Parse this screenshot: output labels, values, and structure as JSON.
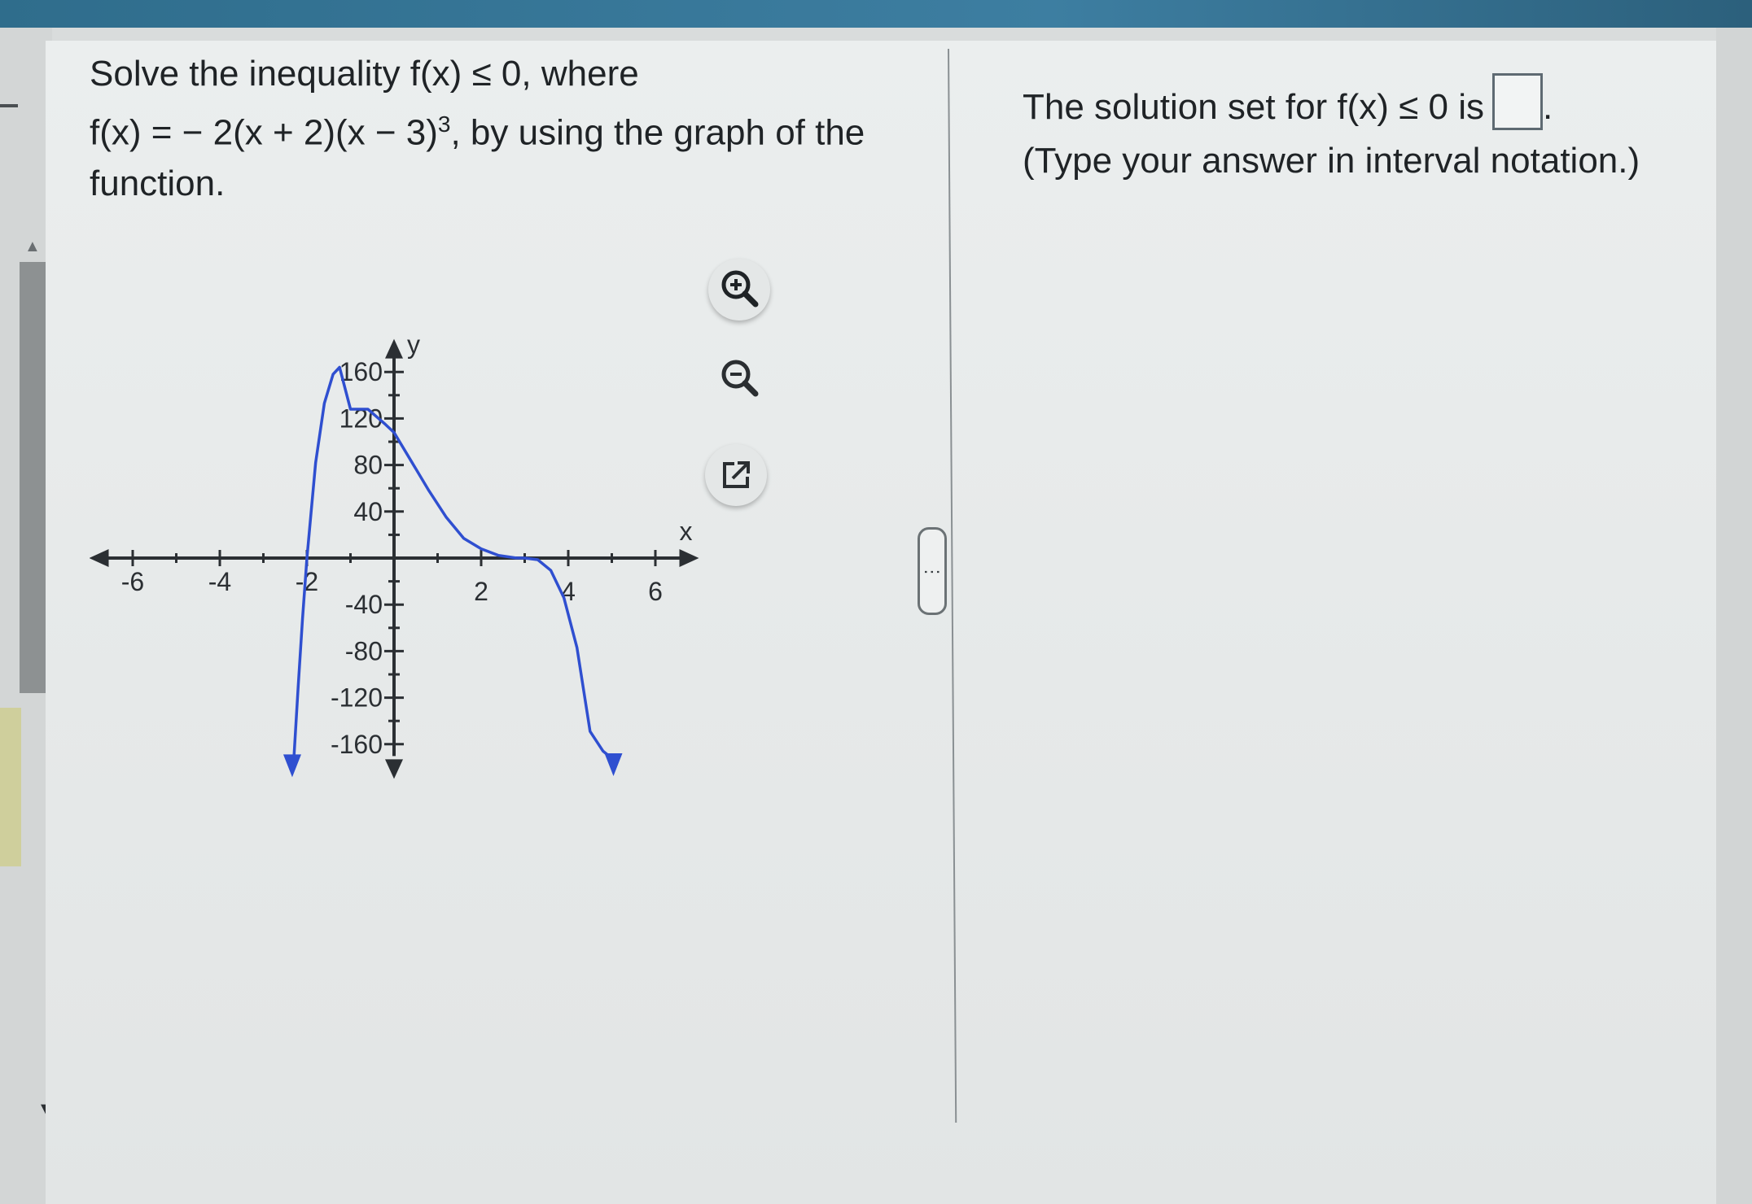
{
  "question": {
    "line1": "Solve the inequality f(x) ≤ 0, where",
    "line2_main": "f(x) = − 2(x + 2)(x − 3)",
    "line2_exp": "3",
    "line2_tail": ", by using the graph of the",
    "line3": "function."
  },
  "answer": {
    "prompt_prefix": "The solution set for f(x) ≤ 0 is",
    "prompt_suffix": ".",
    "hint": "(Type your answer in interval notation.)",
    "answer_value": ""
  },
  "tools": {
    "zoom_in": "zoom-in-icon",
    "zoom_out": "zoom-out-icon",
    "popout": "external-link-icon"
  },
  "chart_data": {
    "type": "line",
    "function": "f(x) = -2(x+2)(x-3)^3",
    "xlabel": "x",
    "ylabel": "y",
    "xlim": [
      -7,
      7
    ],
    "ylim": [
      -180,
      180
    ],
    "x_ticks": [
      "-6",
      "-4",
      "-2",
      "2",
      "4",
      "6"
    ],
    "y_ticks": [
      "160",
      "120",
      "80",
      "40",
      "-40",
      "-80",
      "-120",
      "-160"
    ],
    "color": "#2f4fd0",
    "x": [
      -2.3,
      -2.2,
      -2.1,
      -2.0,
      -1.8,
      -1.6,
      -1.4,
      -1.25,
      -1.0,
      -0.6,
      -0.2,
      0.0,
      0.4,
      0.8,
      1.2,
      1.6,
      2.0,
      2.4,
      2.8,
      3.0,
      3.3,
      3.6,
      3.9,
      4.2,
      4.5,
      4.8,
      5.0
    ],
    "y": [
      -173,
      -110,
      -52,
      0,
      82,
      133,
      158,
      164,
      128,
      128,
      115,
      108,
      83,
      58,
      35,
      17,
      8,
      2.3,
      0.1,
      0,
      -1.4,
      -10.6,
      -34,
      -77,
      -149,
      -166,
      -172
    ]
  }
}
